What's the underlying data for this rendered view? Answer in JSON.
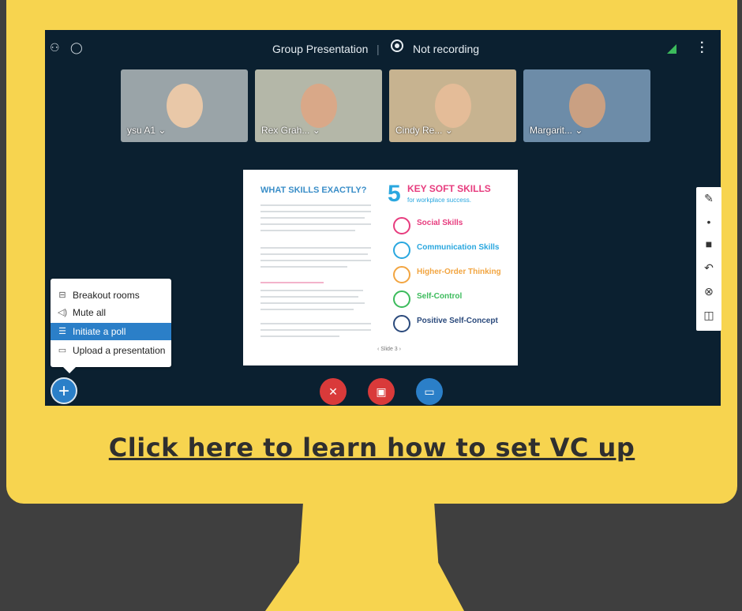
{
  "topbar": {
    "user_icon": "user-icon",
    "chat_icon": "chat-icon",
    "title": "Group Presentation",
    "separator": "|",
    "record_status": "Not recording",
    "signal_icon": "signal-icon",
    "options_icon": "more-vertical-icon"
  },
  "participants": [
    {
      "name": "ysu A1 ⌄",
      "skin": "#e9c8a8",
      "bg": "#9aa4a8"
    },
    {
      "name": "Rex Grah... ⌄",
      "skin": "#d9a888",
      "bg": "#b4b7a8"
    },
    {
      "name": "Cindy Re... ⌄",
      "skin": "#e4bc98",
      "bg": "#c7b390"
    },
    {
      "name": "Margarit... ⌄",
      "skin": "#caa082",
      "bg": "#6d8ca8"
    }
  ],
  "presentation": {
    "left_title": "WHAT SKILLS EXACTLY?",
    "big_number": "5",
    "right_title": "KEY SOFT SKILLS",
    "right_subtitle": "for workplace success.",
    "skills": [
      {
        "label": "Social Skills",
        "color": "#e73c7e"
      },
      {
        "label": "Communication Skills",
        "color": "#2aa7df"
      },
      {
        "label": "Higher-Order Thinking",
        "color": "#f2a541"
      },
      {
        "label": "Self-Control",
        "color": "#3cbb5c"
      },
      {
        "label": "Positive Self-Concept",
        "color": "#2b4a7c"
      }
    ],
    "footer": "‹   Slide 3 ›"
  },
  "whiteboard_tools": [
    "pencil-icon",
    "dot-icon",
    "color-square-icon",
    "undo-icon",
    "clear-icon",
    "multi-user-icon"
  ],
  "action_menu": [
    {
      "label": "Breakout rooms",
      "icon": "breakout-rooms-icon",
      "glyph": "⊟"
    },
    {
      "label": "Mute all",
      "icon": "mute-all-icon",
      "glyph": "◁)"
    },
    {
      "label": "Initiate a poll",
      "icon": "poll-icon",
      "glyph": "☰"
    },
    {
      "label": "Upload a presentation",
      "icon": "presentation-icon",
      "glyph": "▭"
    }
  ],
  "controls": {
    "actions_button": "+",
    "mic": {
      "icon": "mic-off-icon",
      "color": "#d93a3a",
      "glyph": "✕"
    },
    "camera": {
      "icon": "camera-off-icon",
      "color": "#d93a3a",
      "glyph": "▣"
    },
    "screenshare": {
      "icon": "screenshare-icon",
      "color": "#2b7fc8",
      "glyph": "▭"
    }
  },
  "link_text": "Click here to learn how to set VC up"
}
